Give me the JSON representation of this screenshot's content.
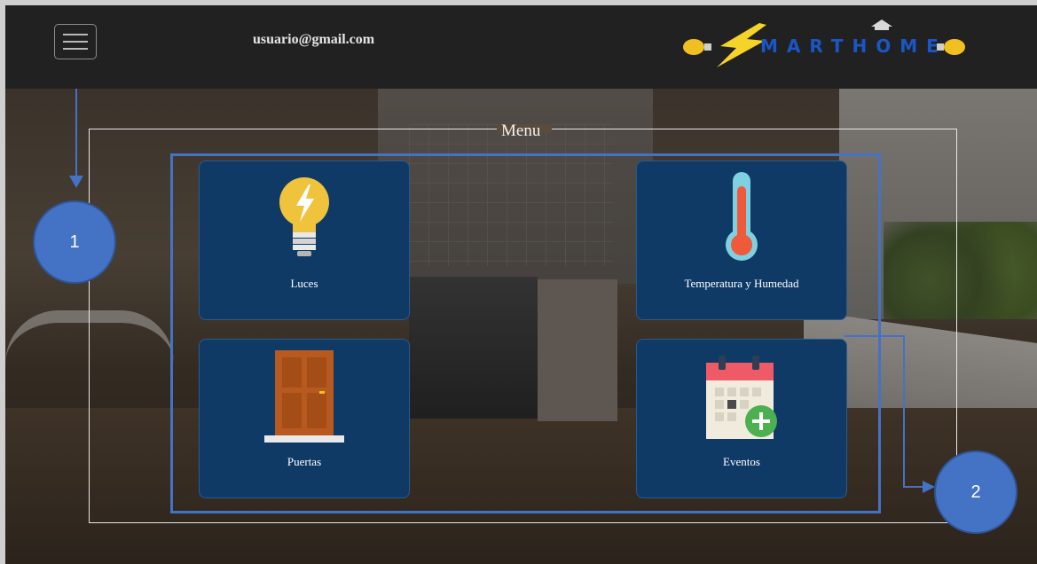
{
  "header": {
    "menu_icon": "hamburger-menu-icon",
    "user_email": "usuario@gmail.com",
    "logo_text": "MARTHOME"
  },
  "menu": {
    "title": "Menu",
    "cards": [
      {
        "label": "Luces",
        "icon": "lightbulb-icon"
      },
      {
        "label": "Temperatura y Humedad",
        "icon": "thermometer-icon"
      },
      {
        "label": "Puertas",
        "icon": "door-icon"
      },
      {
        "label": "Eventos",
        "icon": "calendar-add-icon"
      }
    ]
  },
  "annotations": {
    "callout_1": "1",
    "callout_2": "2"
  },
  "colors": {
    "header_bg": "#212121",
    "card_bg": "#0f3a66",
    "annotation_blue": "#4472c4",
    "logo_blue": "#1a56c4",
    "bolt_yellow": "#f5d328"
  }
}
